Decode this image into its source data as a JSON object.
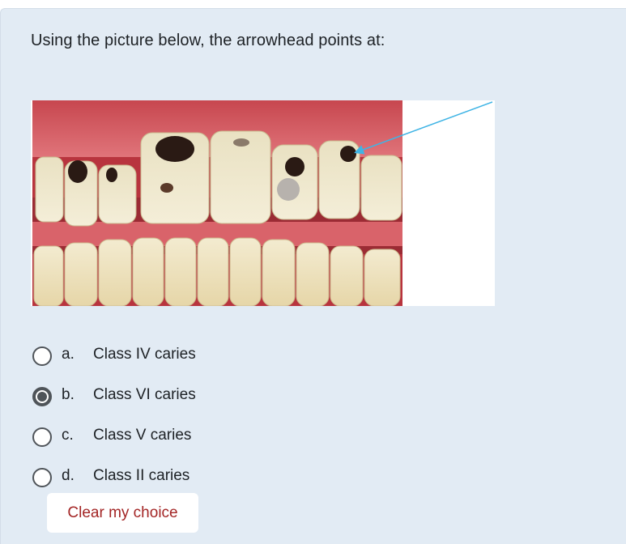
{
  "question": {
    "text": "Using the picture below, the arrowhead points at:"
  },
  "figure": {
    "name": "teeth-photo-with-arrow",
    "arrow_color": "#3fb4e5"
  },
  "answers": [
    {
      "letter": "a.",
      "label": "Class IV caries",
      "selected": false
    },
    {
      "letter": "b.",
      "label": "Class VI caries",
      "selected": true
    },
    {
      "letter": "c.",
      "label": "Class V caries",
      "selected": false
    },
    {
      "letter": "d.",
      "label": "Class II caries",
      "selected": false
    }
  ],
  "clear_button": {
    "label": "Clear my choice",
    "color": "#a32525"
  },
  "colors": {
    "panel_bg": "#e2ebf4",
    "text": "#1d2125"
  }
}
